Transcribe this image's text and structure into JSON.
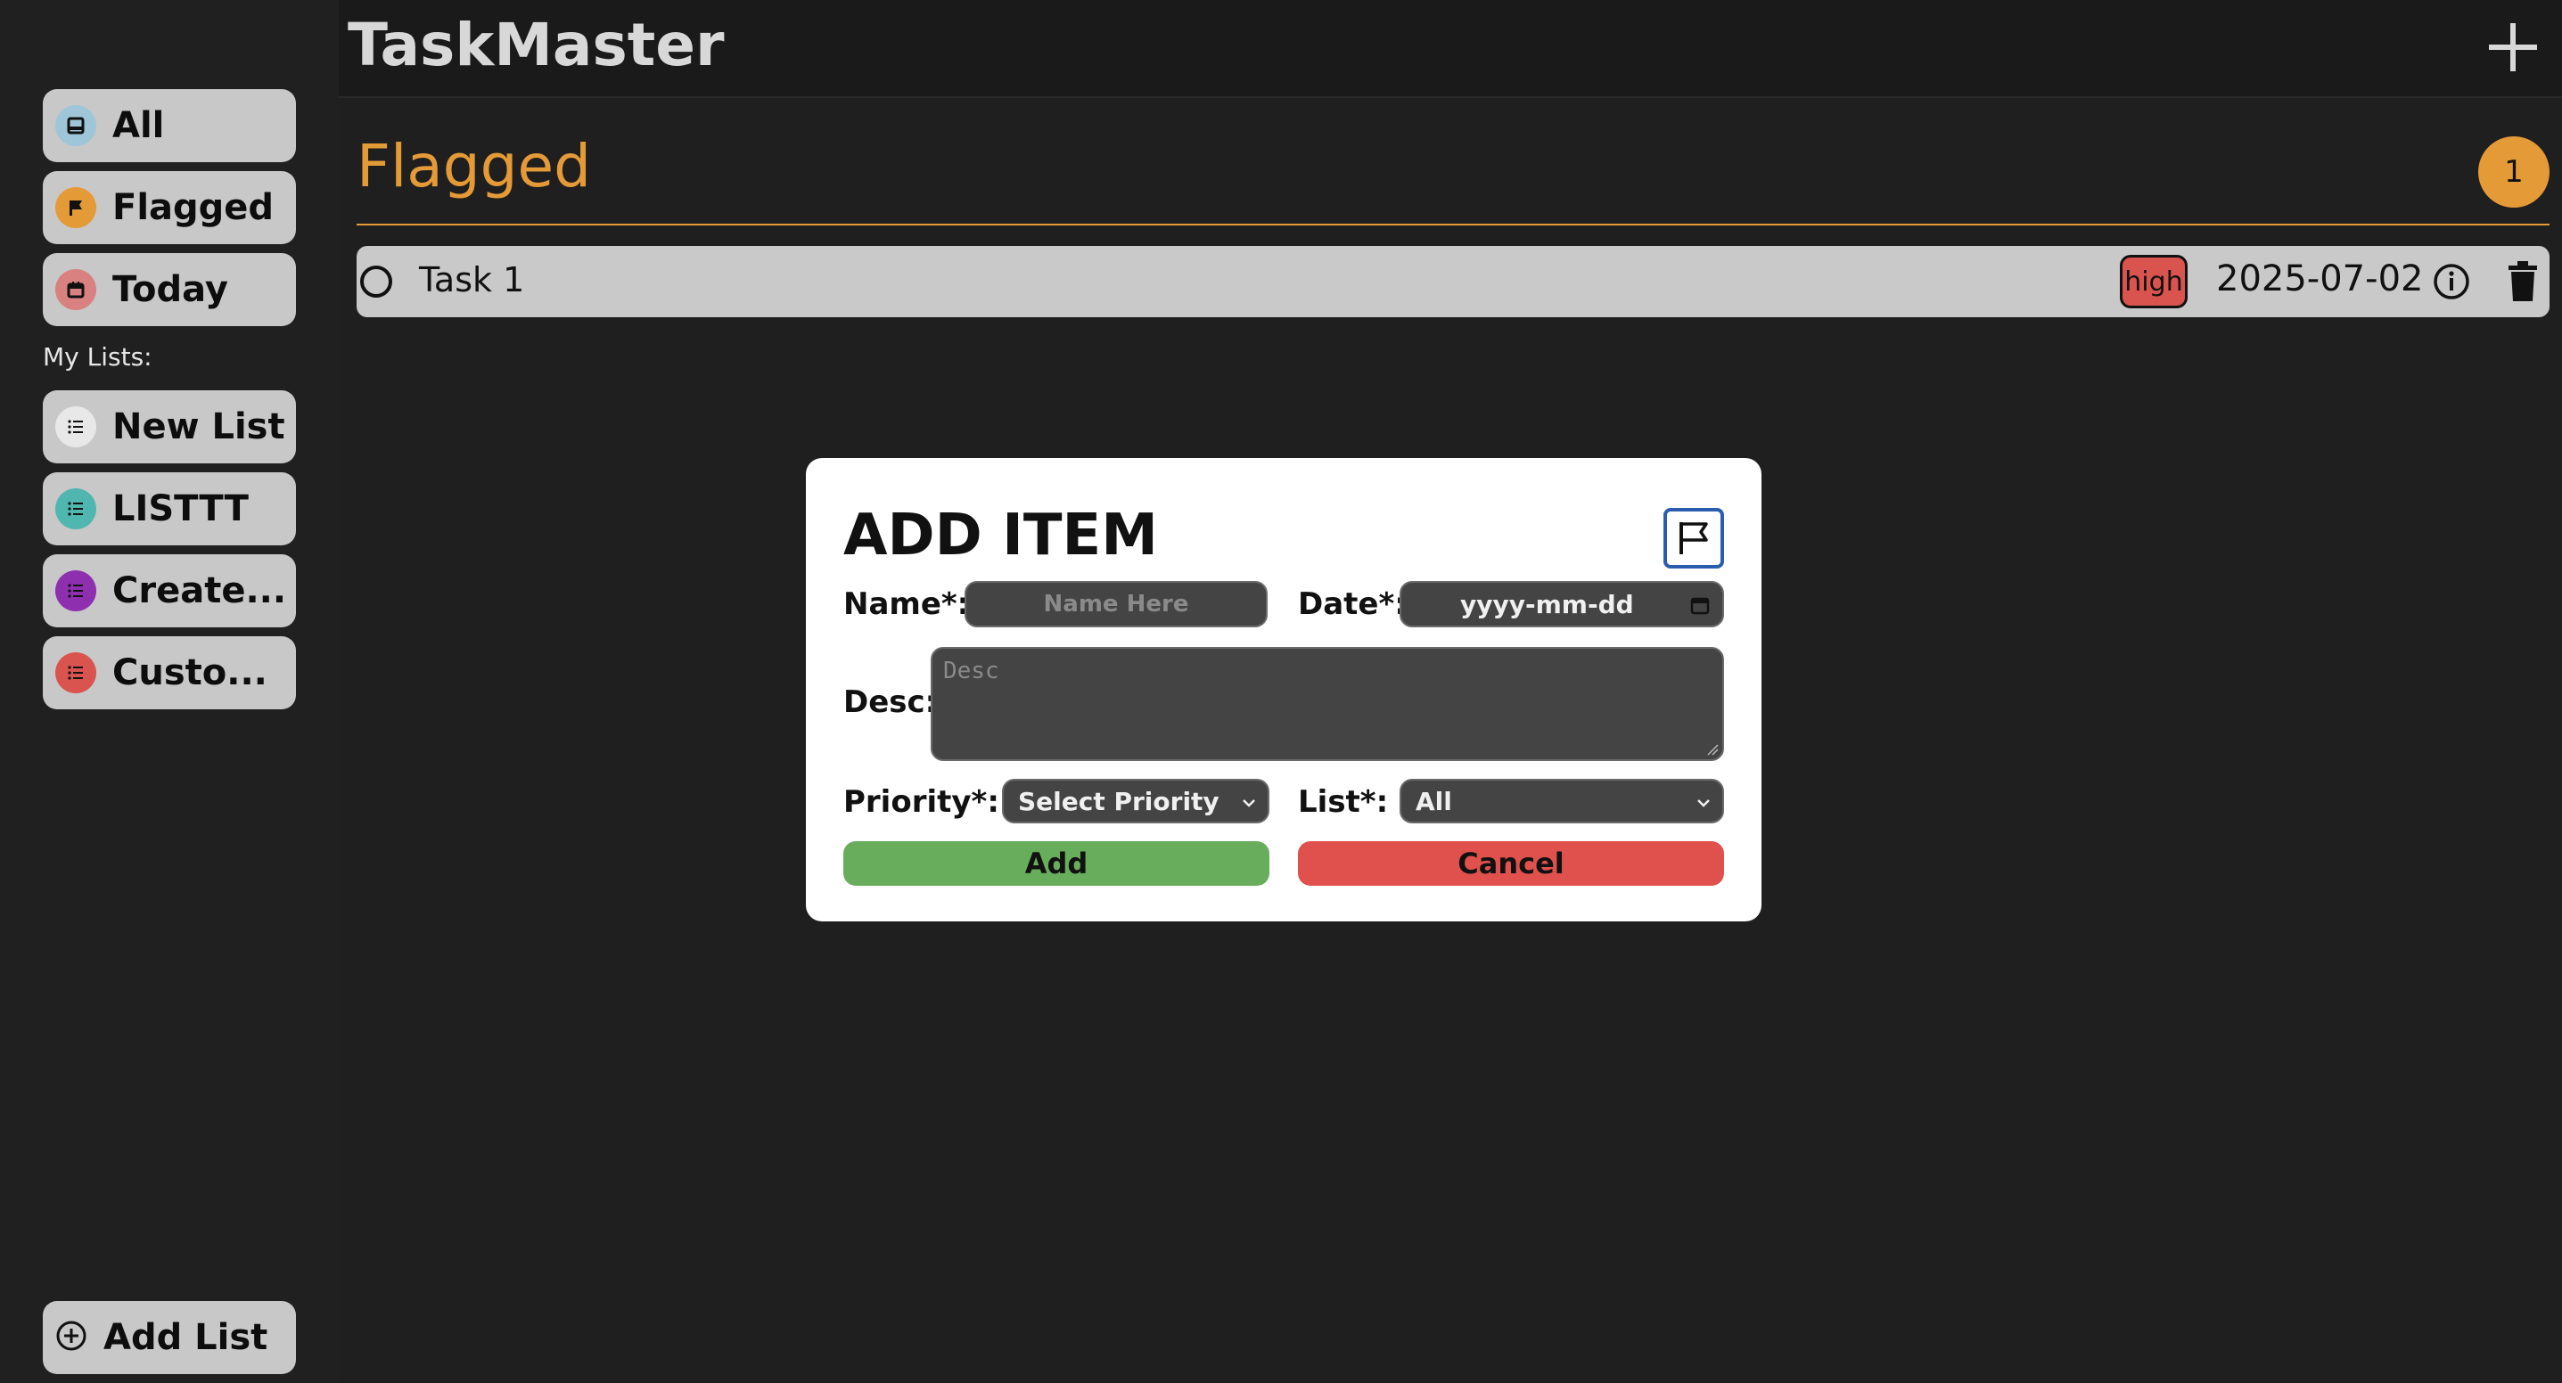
{
  "app": {
    "title": "TaskMaster"
  },
  "sidebar": {
    "smart_lists": [
      {
        "label": "All",
        "icon": "inbox-icon",
        "color": "#9ec6d8"
      },
      {
        "label": "Flagged",
        "icon": "flag-icon",
        "color": "#e59a38"
      },
      {
        "label": "Today",
        "icon": "calendar-icon",
        "color": "#d98080"
      }
    ],
    "my_lists_heading": "My Lists:",
    "lists": [
      {
        "label": "New List",
        "icon": "list-icon",
        "color": "#e8e8e8"
      },
      {
        "label": "LISTTT",
        "icon": "list-icon",
        "color": "#4fb6b0"
      },
      {
        "label": "Create...",
        "icon": "list-icon",
        "color": "#8e2fb0"
      },
      {
        "label": "Custo...",
        "icon": "list-icon",
        "color": "#d9534f"
      }
    ],
    "add_list_label": "Add List"
  },
  "header": {
    "add_icon": "plus-icon"
  },
  "main": {
    "section_title": "Flagged",
    "count": "1",
    "accent": "#e59a38",
    "tasks": [
      {
        "name": "Task 1",
        "priority": "high",
        "date": "2025-07-02"
      }
    ]
  },
  "modal": {
    "title": "ADD ITEM",
    "name_label": "Name*:",
    "name_placeholder": "Name Here",
    "date_label": "Date*:",
    "date_placeholder": "yyyy-mm-dd",
    "desc_label": "Desc:",
    "desc_placeholder": "Desc",
    "priority_label": "Priority*:",
    "priority_value": "Select Priority",
    "list_label": "List*:",
    "list_value": "All",
    "add_label": "Add",
    "cancel_label": "Cancel",
    "add_color": "#68ad5b",
    "cancel_color": "#e0504d"
  }
}
